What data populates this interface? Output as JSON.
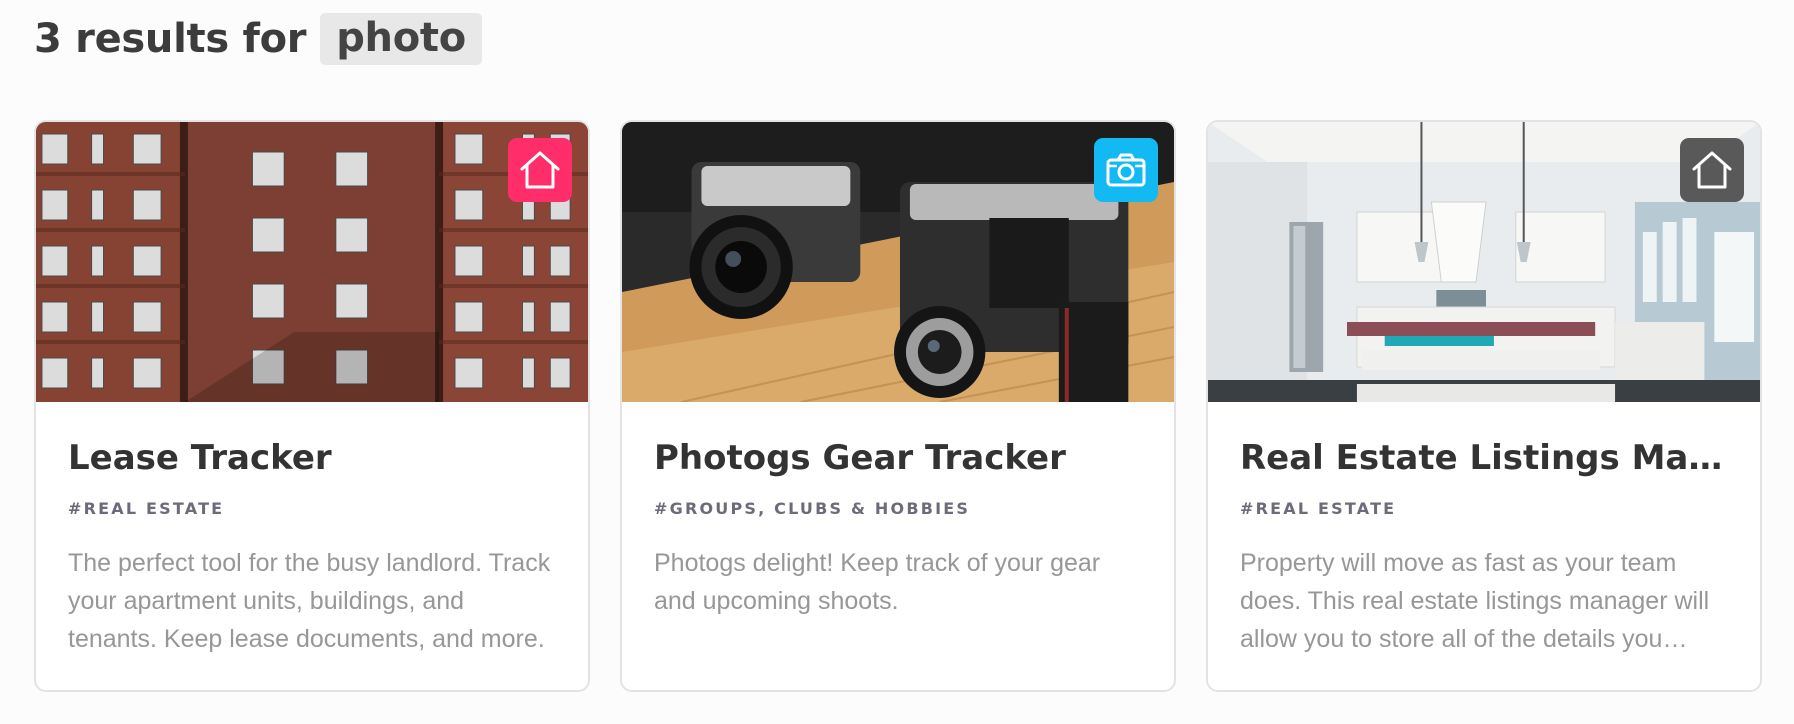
{
  "search": {
    "results_prefix": "3 results for",
    "query": "photo"
  },
  "colors": {
    "real_estate_badge": "#ff2d6a",
    "photo_badge": "#12b9f3",
    "kitchen_badge": "#595959"
  },
  "cards": [
    {
      "title": "Lease Tracker",
      "tag": "#REAL ESTATE",
      "description": "The perfect tool for the busy landlord. Track your apartment units, buildings, and tenants. Keep lease documents, and more.",
      "badge_icon": "house-icon",
      "image": "brick-apartment-building-photo"
    },
    {
      "title": "Photogs Gear Tracker",
      "tag": "#GROUPS, CLUBS & HOBBIES",
      "description": "Photogs delight! Keep track of your gear and upcoming shoots.",
      "badge_icon": "camera-icon",
      "image": "vintage-cameras-photo"
    },
    {
      "title": "Real Estate Listings Mana...",
      "tag": "#REAL ESTATE",
      "description": "Property will move as fast as your team does. This real estate listings manager will allow you to store all of the details you need.",
      "badge_icon": "house-icon",
      "image": "kitchen-interior-photo"
    }
  ]
}
